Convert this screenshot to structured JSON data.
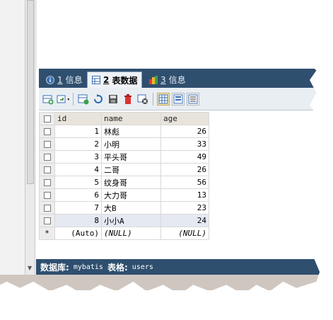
{
  "tabs": [
    {
      "num": "1",
      "label": "信息",
      "icon": "info-icon",
      "active": false
    },
    {
      "num": "2",
      "label": "表数据",
      "icon": "table-icon",
      "active": true
    },
    {
      "num": "3",
      "label": "信息",
      "icon": "colorful-info-icon",
      "active": false
    }
  ],
  "toolbar": {
    "icons": [
      "add-row-icon",
      "insert-dropdown-icon",
      "save-icon",
      "refresh-icon",
      "export-icon",
      "delete-icon",
      "cancel-icon",
      "grid-view-icon",
      "form-view-icon",
      "text-view-icon"
    ]
  },
  "table": {
    "columns": [
      "id",
      "name",
      "age"
    ],
    "rows": [
      {
        "id": "1",
        "name": "林彪",
        "age": "26"
      },
      {
        "id": "2",
        "name": "小明",
        "age": "33"
      },
      {
        "id": "3",
        "name": "平头哥",
        "age": "49"
      },
      {
        "id": "4",
        "name": "二哥",
        "age": "26"
      },
      {
        "id": "5",
        "name": "纹身哥",
        "age": "56"
      },
      {
        "id": "6",
        "name": "大力哥",
        "age": "13"
      },
      {
        "id": "7",
        "name": "大B",
        "age": "23"
      },
      {
        "id": "8",
        "name": "小小A",
        "age": "24"
      }
    ],
    "new_row": {
      "marker": "*",
      "id": "(Auto)",
      "name": "(NULL)",
      "age": "(NULL)"
    }
  },
  "status": {
    "db_label": "数据库:",
    "db_value": "mybatis",
    "table_label": "表格:",
    "table_value": "users"
  },
  "colors": {
    "panel_dark": "#2f4f6f",
    "header_bg": "#e8e4dc",
    "selected_row": "#e4e9f2"
  }
}
